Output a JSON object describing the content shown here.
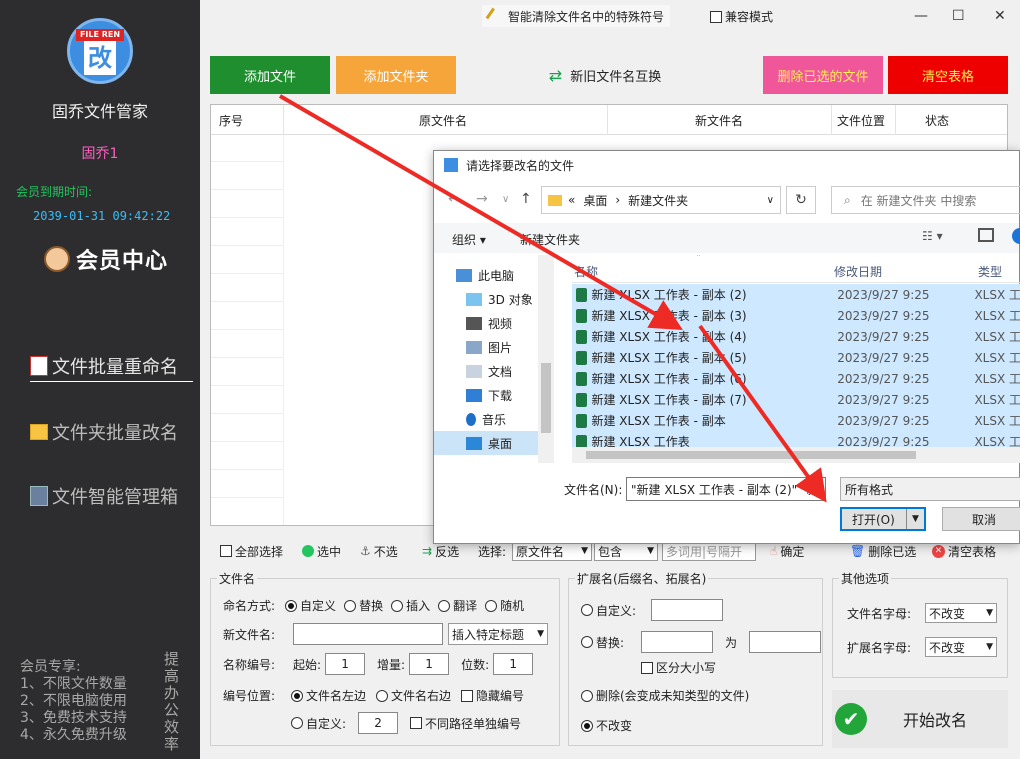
{
  "app": {
    "name": "固乔文件管家",
    "logo_text": "FILE REN",
    "logo_glyph": "改",
    "user": "固乔1",
    "expire_label": "会员到期时间:",
    "expire_value": "2039-01-31 09:42:22",
    "member_center": "会员中心"
  },
  "sidebar": {
    "nav": [
      "文件批量重命名",
      "文件夹批量改名",
      "文件智能管理箱"
    ],
    "vip_lines": [
      "会员专享:",
      "1、不限文件数量",
      "2、不限电脑使用",
      "3、免费技术支持",
      "4、永久免费升级"
    ],
    "vertical_text": "提高办公效率"
  },
  "titlebar": {
    "magic_label": "智能清除文件名中的特殊符号",
    "compat_label": "兼容模式",
    "min": "—",
    "max": "☐",
    "close": "✕"
  },
  "actions": {
    "add_file": "添加文件",
    "add_folder": "添加文件夹",
    "swap": "新旧文件名互换",
    "delete_selected": "删除已选的文件",
    "clear_table": "清空表格"
  },
  "table": {
    "headers": [
      "序号",
      "原文件名",
      "新文件名",
      "文件位置",
      "状态"
    ]
  },
  "seltool": {
    "select_all": "全部选择",
    "check": "选中",
    "uncheck": "不选",
    "invert": "反选",
    "select_label": "选择:",
    "field": "原文件名",
    "match": "包含",
    "keywords_placeholder": "多词用|号隔开",
    "confirm": "确定",
    "delete_checked": "删除已选",
    "clear_table": "清空表格"
  },
  "filename_panel": {
    "legend": "文件名",
    "mode_label": "命名方式:",
    "modes": [
      "自定义",
      "替换",
      "插入",
      "翻译",
      "随机"
    ],
    "new_name_label": "新文件名:",
    "insert_title": "插入特定标题",
    "numbering_label": "名称编号:",
    "start_label": "起始:",
    "start": "1",
    "step_label": "增量:",
    "step": "1",
    "digits_label": "位数:",
    "digits": "1",
    "position_label": "编号位置:",
    "pos_left": "文件名左边",
    "pos_right": "文件名右边",
    "hide_number": "隐藏编号",
    "custom": "自定义:",
    "custom_value": "2",
    "separate": "不同路径单独编号"
  },
  "ext_panel": {
    "legend": "扩展名(后缀名、拓展名)",
    "custom": "自定义:",
    "replace": "替换:",
    "to": "为",
    "case": "区分大小写",
    "delete": "删除(会变成未知类型的文件)",
    "nochange": "不改变"
  },
  "other_panel": {
    "legend": "其他选项",
    "name_case_label": "文件名字母:",
    "name_case": "不改变",
    "ext_case_label": "扩展名字母:",
    "ext_case": "不改变"
  },
  "start_button": "开始改名",
  "dialog": {
    "title": "请选择要改名的文件",
    "breadcrumb": [
      "«",
      "桌面",
      "›",
      "新建文件夹"
    ],
    "search_placeholder": "在 新建文件夹 中搜索",
    "organize": "组织 ▾",
    "new_folder": "新建文件夹",
    "tree": [
      "此电脑",
      "3D 对象",
      "视频",
      "图片",
      "文档",
      "下载",
      "音乐",
      "桌面"
    ],
    "columns": [
      "名称",
      "修改日期",
      "类型"
    ],
    "files": [
      {
        "name": "新建 XLSX 工作表 - 副本 (2)",
        "date": "2023/9/27 9:25",
        "type": "XLSX 工"
      },
      {
        "name": "新建 XLSX 工作表 - 副本 (3)",
        "date": "2023/9/27 9:25",
        "type": "XLSX 工"
      },
      {
        "name": "新建 XLSX 工作表 - 副本 (4)",
        "date": "2023/9/27 9:25",
        "type": "XLSX 工"
      },
      {
        "name": "新建 XLSX 工作表 - 副本 (5)",
        "date": "2023/9/27 9:25",
        "type": "XLSX 工"
      },
      {
        "name": "新建 XLSX 工作表 - 副本 (6)",
        "date": "2023/9/27 9:25",
        "type": "XLSX 工"
      },
      {
        "name": "新建 XLSX 工作表 - 副本 (7)",
        "date": "2023/9/27 9:25",
        "type": "XLSX 工"
      },
      {
        "name": "新建 XLSX 工作表 - 副本",
        "date": "2023/9/27 9:25",
        "type": "XLSX 工"
      },
      {
        "name": "新建 XLSX 工作表",
        "date": "2023/9/27 9:25",
        "type": "XLSX 工"
      }
    ],
    "filename_label": "文件名(N):",
    "filename_value": "\"新建 XLSX 工作表 - 副本 (2)\" \"新",
    "filter": "所有格式",
    "open": "打开(O)",
    "cancel": "取消"
  },
  "colors": {
    "sidebar_bg": "#2d2d2f",
    "add_file": "#1e8e2e",
    "add_folder": "#f6a53a",
    "delete_selected": "#f0569a",
    "clear_table": "#ee0000",
    "arrow": "#ee2a24",
    "selection": "#cde8ff"
  }
}
